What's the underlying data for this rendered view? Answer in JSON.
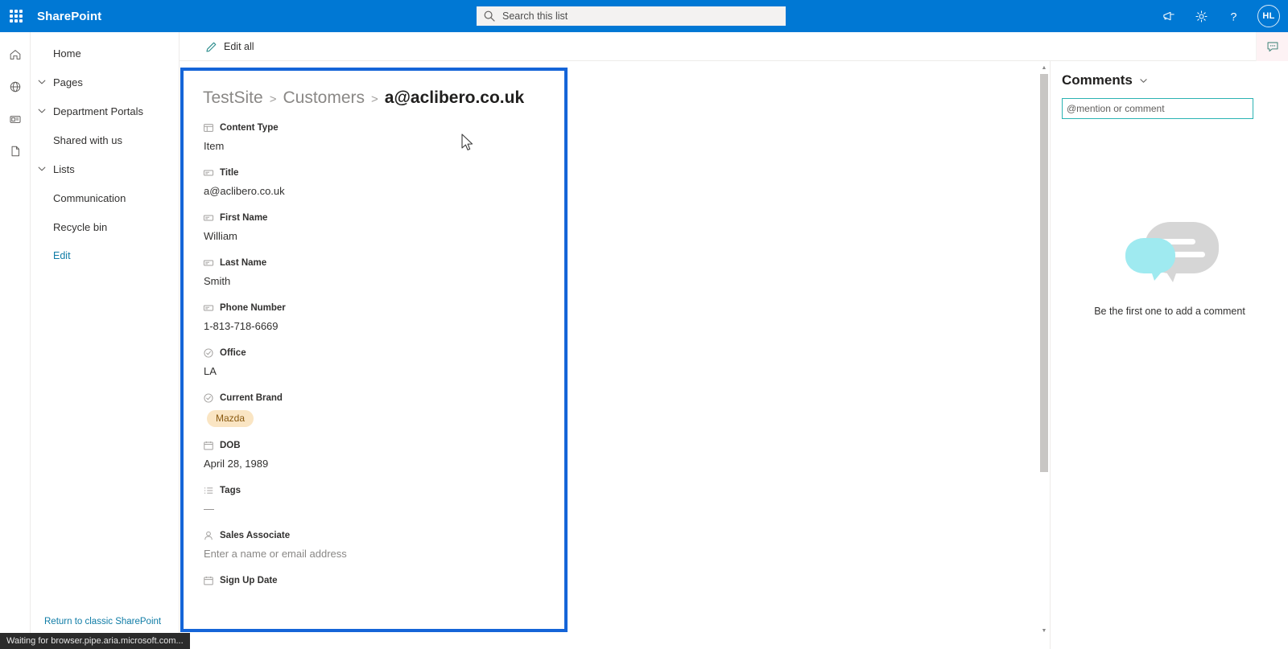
{
  "suite": {
    "waffle_label": "App launcher",
    "brand": "SharePoint",
    "search_placeholder": "Search this list",
    "search_value": "",
    "icons": {
      "megaphone": "megaphone-icon",
      "settings": "gear-icon",
      "help": "help-icon"
    },
    "avatar_initials": "HL"
  },
  "rail": {
    "items": [
      {
        "name": "home-icon",
        "label": "Home"
      },
      {
        "name": "globe-icon",
        "label": "Sites"
      },
      {
        "name": "news-icon",
        "label": "News"
      },
      {
        "name": "document-icon",
        "label": "Files"
      }
    ]
  },
  "sidebar": {
    "items": [
      {
        "label": "Home",
        "expandable": false
      },
      {
        "label": "Pages",
        "expandable": true
      },
      {
        "label": "Department Portals",
        "expandable": true
      },
      {
        "label": "Shared with us",
        "expandable": false
      },
      {
        "label": "Lists",
        "expandable": true
      },
      {
        "label": "Communication",
        "expandable": false
      },
      {
        "label": "Recycle bin",
        "expandable": false
      },
      {
        "label": "Edit",
        "expandable": false,
        "link": true
      }
    ],
    "footer_link": "Return to classic SharePoint"
  },
  "commandbar": {
    "edit_all_label": "Edit all",
    "comments_toggle": "comments-icon"
  },
  "form": {
    "breadcrumb": {
      "site": "TestSite",
      "list": "Customers",
      "separator": ">",
      "current": "a@aclibero.co.uk"
    },
    "fields": [
      {
        "icon": "content-type-icon",
        "label": "Content Type",
        "value": "Item",
        "kind": "text"
      },
      {
        "icon": "textbox-icon",
        "label": "Title",
        "value": "a@aclibero.co.uk",
        "kind": "text"
      },
      {
        "icon": "textbox-icon",
        "label": "First Name",
        "value": "William",
        "kind": "text"
      },
      {
        "icon": "textbox-icon",
        "label": "Last Name",
        "value": "Smith",
        "kind": "text"
      },
      {
        "icon": "textbox-icon",
        "label": "Phone Number",
        "value": "1-813-718-6669",
        "kind": "text"
      },
      {
        "icon": "choice-icon",
        "label": "Office",
        "value": "LA",
        "kind": "text"
      },
      {
        "icon": "choice-icon",
        "label": "Current Brand",
        "value": "Mazda",
        "kind": "pill"
      },
      {
        "icon": "calendar-icon",
        "label": "DOB",
        "value": "April 28, 1989",
        "kind": "text"
      },
      {
        "icon": "list-icon",
        "label": "Tags",
        "value": "—",
        "kind": "dash"
      },
      {
        "icon": "person-icon",
        "label": "Sales Associate",
        "value": "Enter a name or email address",
        "kind": "placeholder"
      },
      {
        "icon": "calendar-icon",
        "label": "Sign Up Date",
        "value": "",
        "kind": "text"
      }
    ],
    "pill_background": "#fae5c3",
    "pill_text_color": "#8a5a10",
    "highlight_color": "#1565d8"
  },
  "comments": {
    "title": "Comments",
    "collapse_icon": "chevron-down-icon",
    "input_placeholder": "@mention or comment",
    "input_value": "",
    "empty_text": "Be the first one to add a comment"
  },
  "statusbar": {
    "text": "Waiting for browser.pipe.aria.microsoft.com..."
  }
}
